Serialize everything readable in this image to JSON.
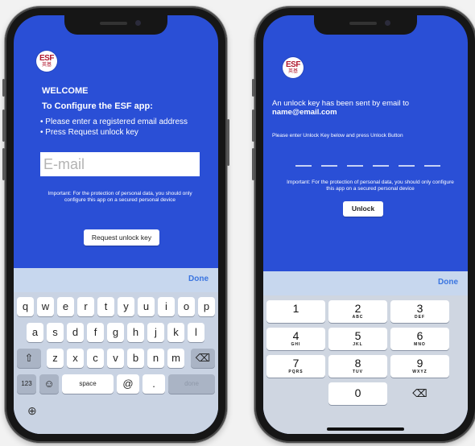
{
  "left_screen": {
    "logo": {
      "line1": "ESF",
      "line2": "英基"
    },
    "title": "WELCOME",
    "subtitle": "To Configure the ESF app:",
    "bullets": [
      "• Please enter a registered email address",
      "• Press Request unlock key"
    ],
    "email_input": {
      "placeholder": "E-mail",
      "value": ""
    },
    "note": "Important: For the protection of personal data, you should only configure this app on a secured personal device",
    "request_button": "Request unlock key",
    "keyboard": {
      "done_label": "Done",
      "row1": [
        "q",
        "w",
        "e",
        "r",
        "t",
        "y",
        "u",
        "i",
        "o",
        "p"
      ],
      "row2": [
        "a",
        "s",
        "d",
        "f",
        "g",
        "h",
        "j",
        "k",
        "l"
      ],
      "row3": [
        "z",
        "x",
        "c",
        "v",
        "b",
        "n",
        "m"
      ],
      "shift_glyph": "⇧",
      "delete_glyph": "⌫",
      "numbers_label": "123",
      "emoji_glyph": "☺",
      "space_label": "space",
      "at_label": "@",
      "dot_label": ".",
      "return_label": "done",
      "globe_glyph": "⊕"
    }
  },
  "right_screen": {
    "logo": {
      "line1": "ESF",
      "line2": "英基"
    },
    "message_line1": "An unlock key has been sent by email to",
    "email": "name@email.com",
    "instruction": "Please enter Unlock Key below and press Unlock Button",
    "note": "Important: For the protection of personal data, you should only configure this app on a secured personal device",
    "unlock_button": "Unlock",
    "numpad": {
      "done_label": "Done",
      "keys": [
        {
          "num": "1",
          "sub": ""
        },
        {
          "num": "2",
          "sub": "ABC"
        },
        {
          "num": "3",
          "sub": "DEF"
        },
        {
          "num": "4",
          "sub": "GHI"
        },
        {
          "num": "5",
          "sub": "JKL"
        },
        {
          "num": "6",
          "sub": "MNO"
        },
        {
          "num": "7",
          "sub": "PQRS"
        },
        {
          "num": "8",
          "sub": "TUV"
        },
        {
          "num": "9",
          "sub": "WXYZ"
        },
        {
          "num": "0",
          "sub": ""
        }
      ],
      "delete_glyph": "⌫"
    }
  },
  "colors": {
    "screen_blue": "#2a4fd6",
    "logo_red": "#b0182e",
    "done_blue": "#3a75e0"
  }
}
